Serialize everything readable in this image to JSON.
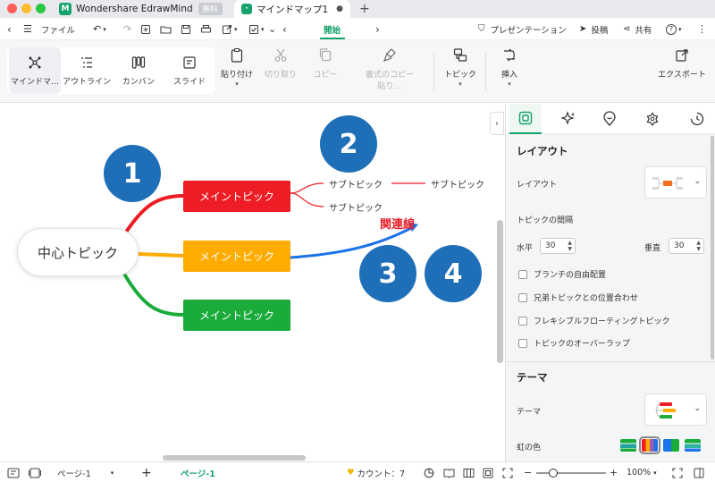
{
  "tabbar": {
    "app_title": "Wondershare EdrawMind",
    "app_badge": "無料",
    "doc_tab": "マインドマップ1",
    "new_tab": "+"
  },
  "menubar": {
    "file": "ファイル",
    "start": "開始",
    "presentation": "プレゼンテーション",
    "post": "投稿",
    "share": "共有"
  },
  "ribbon": {
    "views": [
      "マインドマ…",
      "アウトライン",
      "カンバン",
      "スライド"
    ],
    "paste": "貼り付け",
    "cut": "切り取り",
    "copy": "コピー",
    "format_copy_1": "書式のコピー",
    "format_copy_2": "貼り…",
    "topic": "トピック",
    "insert": "挿入",
    "export": "エクスポート"
  },
  "canvas": {
    "center": "中心トピック",
    "mains": [
      "メイントピック",
      "メイントピック",
      "メイントピック"
    ],
    "subs": [
      "サブトピック",
      "サブトピック",
      "サブトピック"
    ],
    "relation_label": "関連線",
    "numbers": [
      "1",
      "2",
      "3",
      "4"
    ],
    "colors": {
      "red": "#ee1c24",
      "orange": "#ffac00",
      "green": "#1aab3b",
      "blue": "#1f6fb8",
      "relation": "#1a73e8"
    }
  },
  "panel": {
    "layout_heading": "レイアウト",
    "layout_label": "レイアウト",
    "spacing_label": "トピックの間隔",
    "horizontal": "水平",
    "horizontal_value": "30",
    "vertical": "垂直",
    "vertical_value": "30",
    "options": [
      "ブランチの自由配置",
      "兄弟トピックとの位置合わせ",
      "フレキシブルフローティングトピック",
      "トピックのオーバーラップ"
    ],
    "theme_heading": "テーマ",
    "theme_label": "テーマ",
    "rainbow_label": "虹の色"
  },
  "status": {
    "page_dropdown": "ページ-1",
    "add": "+",
    "page_tab": "ページ-1",
    "count": "カウント：7",
    "zoom_minus": "−",
    "zoom_plus": "+",
    "zoom": "100%"
  }
}
